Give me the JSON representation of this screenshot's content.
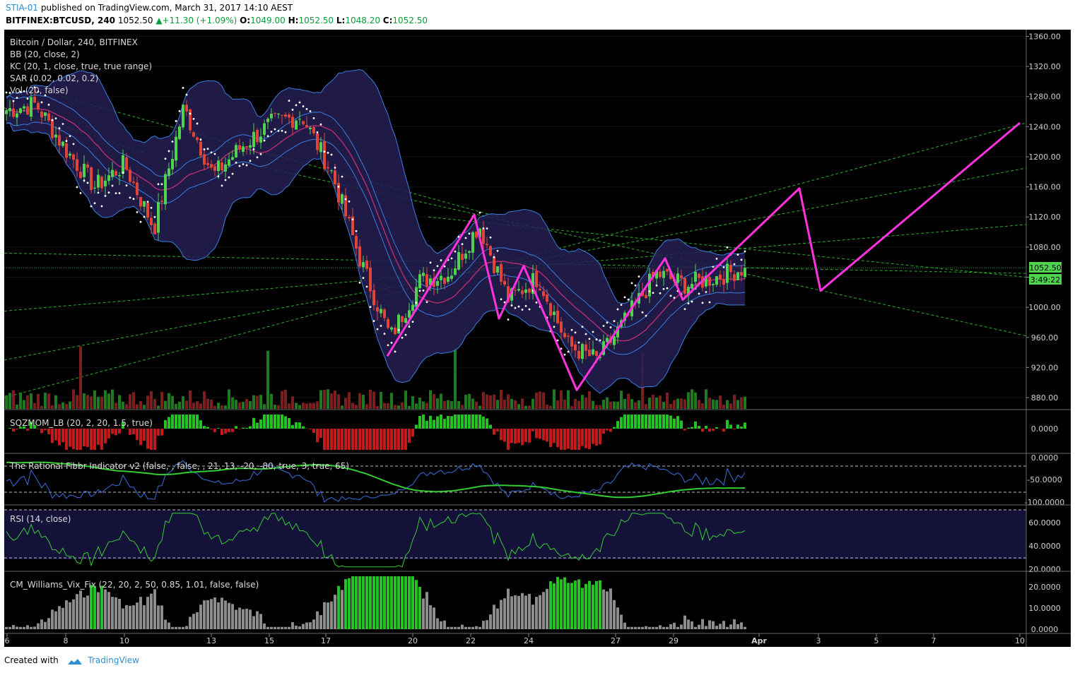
{
  "header": {
    "user": "STIA-01",
    "published_text": " published on TradingView.com, March 31, 2017 14:10 AEST",
    "symbol": "BITFINEX:BTCUSD, 240",
    "last": "1052.50",
    "change": "+11.30 (+1.09%)",
    "o_label": "O:",
    "o_val": "1049.00",
    "h_label": "H:",
    "h_val": "1052.50",
    "l_label": "L:",
    "l_val": "1048.20",
    "c_label": "C:",
    "c_val": "1052.50"
  },
  "legend": {
    "title": "Bitcoin / Dollar, 240, BITFINEX",
    "bb": "BB (20, close, 2)",
    "kc": "KC (20, 1, close, true, true range)",
    "sar": "SAR (0.02, 0.02, 0.2)",
    "vol": "Vol (20, false)"
  },
  "panes": {
    "sqz": "SQZMOM_LB (20, 2, 20, 1.5, true)",
    "fibbr": "The Rational Fibbr Indicator v2 (false, , false, , 21, 13, -20, -80, true, 3, true, 65)",
    "rsi": "RSI (14, close)",
    "vix": "CM_Williams_Vix_Fix (22, 20, 2, 50, 0.85, 1.01, false, false)"
  },
  "price_badge": "1052.50",
  "timer_badge": "3:49:22",
  "footer": {
    "created": "Created with",
    "brand": "TradingView"
  },
  "colors": {
    "background": "#000000",
    "up": "#4fd34f",
    "down": "#e0453a",
    "projection": "#ff33dd",
    "bb_fill": "#241e52",
    "band": "#3b7fe0",
    "sar": "#ffffff",
    "trend": "#33cc33"
  },
  "chart_data": [
    {
      "type": "candlestick",
      "title": "Bitcoin / Dollar, 240, BITFINEX",
      "y_ticks": [
        "1360.00",
        "1320.00",
        "1280.00",
        "1240.00",
        "1200.00",
        "1160.00",
        "1120.00",
        "1080.00",
        "1040.00",
        "1000.00",
        "960.00",
        "920.00",
        "880.00"
      ],
      "x_ticks": [
        "6",
        "8",
        "10",
        "13",
        "15",
        "17",
        "20",
        "22",
        "24",
        "27",
        "29",
        "Apr",
        "3",
        "5",
        "7",
        "10"
      ],
      "ylim": [
        865,
        1367
      ],
      "close_path": [
        {
          "date": "Mar 6",
          "price": 1262
        },
        {
          "date": "Mar 7",
          "price": 1270
        },
        {
          "date": "Mar 8",
          "price": 1210
        },
        {
          "date": "Mar 9",
          "price": 1160
        },
        {
          "date": "Mar 10",
          "price": 1190
        },
        {
          "date": "Mar 11",
          "price": 1105
        },
        {
          "date": "Mar 11b",
          "price": 1265
        },
        {
          "date": "Mar 12",
          "price": 1175
        },
        {
          "date": "Mar 13",
          "price": 1215
        },
        {
          "date": "Mar 15",
          "price": 1245
        },
        {
          "date": "Mar 16",
          "price": 1255
        },
        {
          "date": "Mar 17",
          "price": 1180
        },
        {
          "date": "Mar 18",
          "price": 1060
        },
        {
          "date": "Mar 19",
          "price": 960
        },
        {
          "date": "Mar 20",
          "price": 1035
        },
        {
          "date": "Mar 21",
          "price": 1045
        },
        {
          "date": "Mar 22",
          "price": 1110
        },
        {
          "date": "Mar 23",
          "price": 1010
        },
        {
          "date": "Mar 24",
          "price": 1040
        },
        {
          "date": "Mar 25",
          "price": 950
        },
        {
          "date": "Mar 26",
          "price": 930
        },
        {
          "date": "Mar 27",
          "price": 985
        },
        {
          "date": "Mar 28",
          "price": 1045
        },
        {
          "date": "Mar 29",
          "price": 1030
        },
        {
          "date": "Mar 30",
          "price": 1040
        },
        {
          "date": "Mar 31",
          "price": 1052.5
        }
      ],
      "projection": [
        {
          "point": "A",
          "price": 935
        },
        {
          "point": "B",
          "price": 1123
        },
        {
          "point": "C",
          "price": 985
        },
        {
          "point": "D",
          "price": 1055
        },
        {
          "point": "E",
          "price": 890
        },
        {
          "point": "F",
          "price": 1065
        },
        {
          "point": "G",
          "price": 1010
        },
        {
          "point": "H",
          "price": 1158
        },
        {
          "point": "I",
          "price": 1022
        },
        {
          "point": "J",
          "price": 1245
        }
      ]
    }
  ]
}
